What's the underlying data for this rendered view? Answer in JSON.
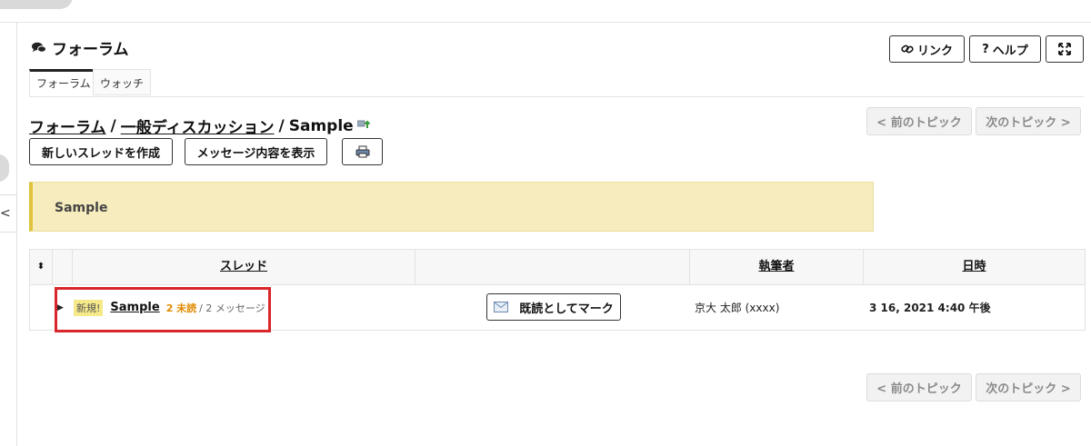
{
  "page": {
    "title": "フォーラム",
    "tabs": [
      {
        "label": "フォーラム"
      },
      {
        "label": "ウォッチ"
      }
    ]
  },
  "toolbar": {
    "link_label": "リンク",
    "help_label": "ヘルプ"
  },
  "breadcrumb": {
    "items": [
      "フォーラム",
      "一般ディスカッション",
      "Sample"
    ],
    "separator": "/"
  },
  "actions": {
    "new_thread": "新しいスレッドを作成",
    "show_messages": "メッセージ内容を表示"
  },
  "nav": {
    "prev_topic": "< 前のトピック",
    "next_topic": "次のトピック >"
  },
  "banner": {
    "text": "Sample"
  },
  "table": {
    "headers": {
      "sort": "⬍",
      "thread": "スレッド",
      "author": "執筆者",
      "date": "日時"
    },
    "rows": [
      {
        "new_badge": "新規!",
        "title": "Sample",
        "unread": "2 未読",
        "messages": "/ 2 メッセージ",
        "mark_read": "既読としてマーク",
        "author": "京大 太郎 (xxxx)",
        "date": "3 16, 2021 4:40 午後"
      }
    ]
  },
  "left_tab": {
    "glyph": "<"
  }
}
